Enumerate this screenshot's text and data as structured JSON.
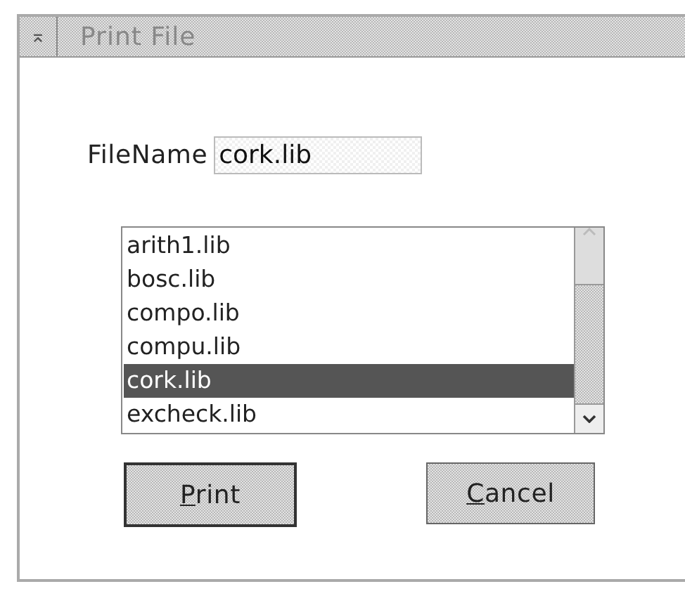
{
  "window": {
    "title": "Print File",
    "menu_glyph": "⌅"
  },
  "file_name": {
    "label": "FileName",
    "value": "cork.lib"
  },
  "files": [
    {
      "name": "arith1.lib",
      "selected": false
    },
    {
      "name": "bosc.lib",
      "selected": false
    },
    {
      "name": "compo.lib",
      "selected": false
    },
    {
      "name": "compu.lib",
      "selected": false
    },
    {
      "name": "cork.lib",
      "selected": true
    },
    {
      "name": "excheck.lib",
      "selected": false
    }
  ],
  "buttons": [
    {
      "label": "Print",
      "mnemonic_underlined": true,
      "default": true
    },
    {
      "label": "Cancel",
      "mnemonic_underlined": true,
      "default": false
    }
  ]
}
